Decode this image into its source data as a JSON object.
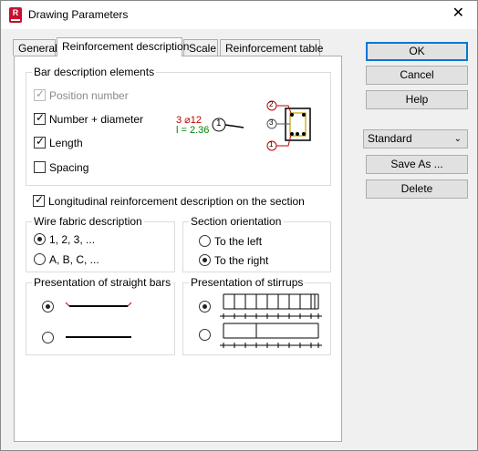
{
  "window": {
    "title": "Drawing Parameters",
    "app_icon_letter": "R"
  },
  "tabs": [
    {
      "label": "General"
    },
    {
      "label": "Reinforcement description"
    },
    {
      "label": "Scale"
    },
    {
      "label": "Reinforcement table"
    }
  ],
  "bar_description": {
    "title": "Bar description elements",
    "position_number": "Position number",
    "number_diameter": "Number + diameter",
    "length": "Length",
    "spacing": "Spacing",
    "preview": {
      "quantity_diameter": "3 ⌀12",
      "length_text": "l = 2.36",
      "tag_1": "1",
      "tag_2": "2",
      "tag_3": "3"
    }
  },
  "longitudinal_label": "Longitudinal reinforcement description on the section",
  "wire_fabric": {
    "title": "Wire fabric description",
    "opt1": "1, 2, 3, ...",
    "opt2": "A, B, C, ..."
  },
  "section_orientation": {
    "title": "Section orientation",
    "opt1": "To the left",
    "opt2": "To the right"
  },
  "straight_bars": {
    "title": "Presentation of straight bars"
  },
  "stirrups": {
    "title": "Presentation of stirrups"
  },
  "buttons": {
    "ok": "OK",
    "cancel": "Cancel",
    "help": "Help",
    "save_as": "Save As ...",
    "delete": "Delete"
  },
  "standard_select": {
    "value": "Standard"
  },
  "colors": {
    "red": "#c00000",
    "green": "#008000",
    "accent": "#0078d7"
  }
}
